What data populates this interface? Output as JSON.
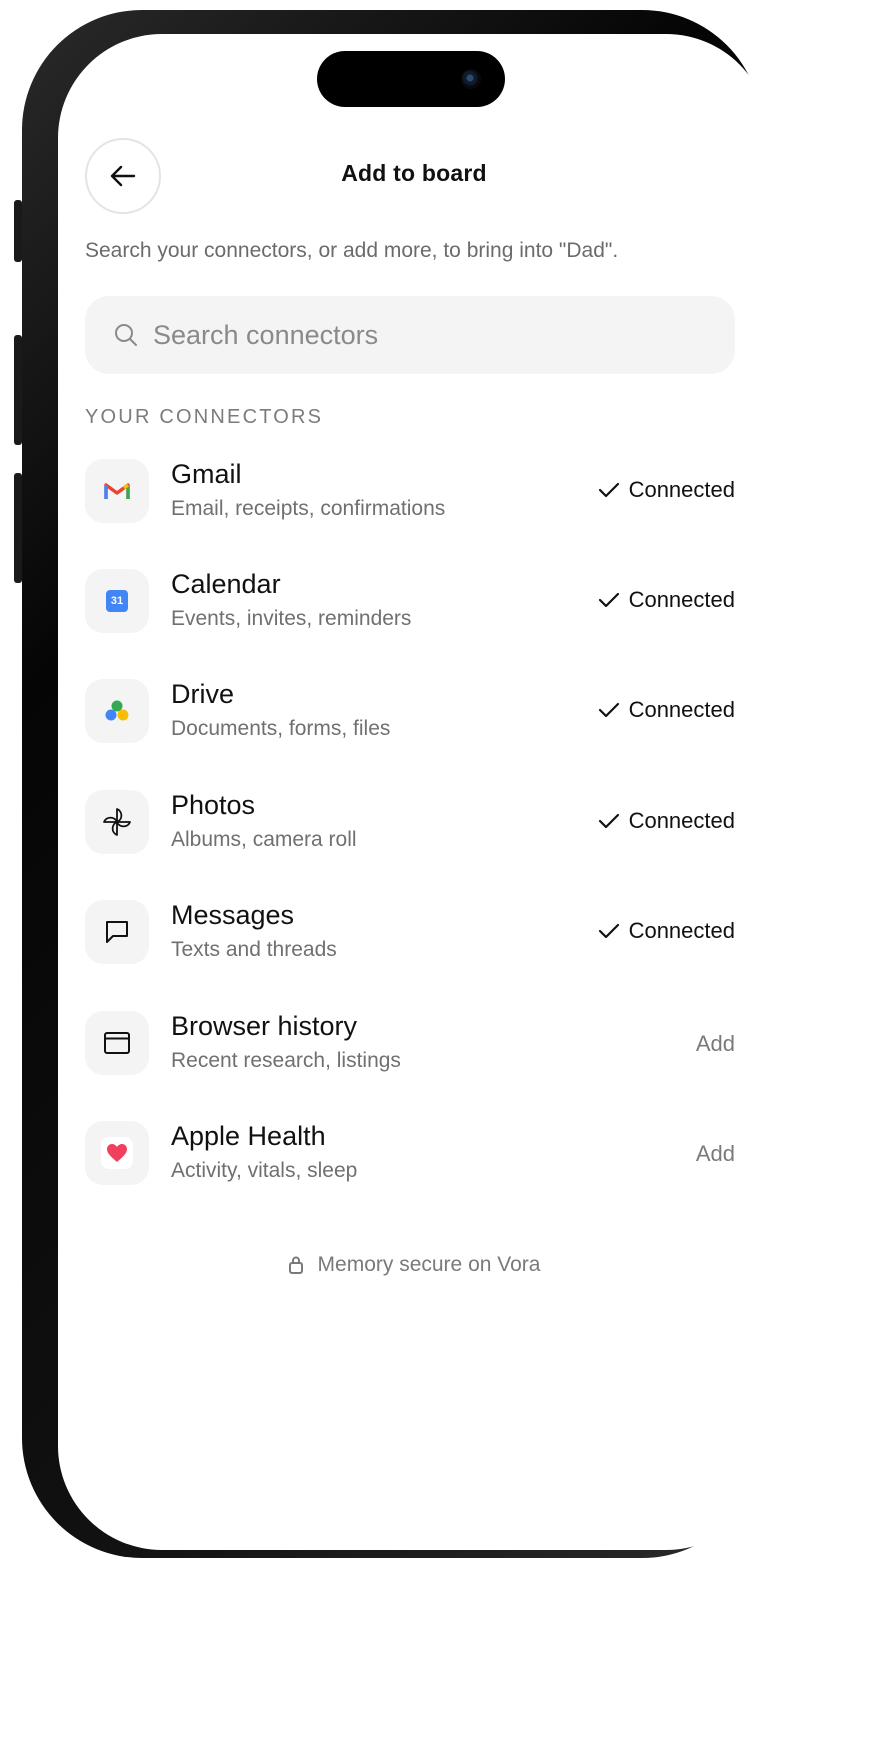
{
  "header": {
    "title": "Add to board",
    "subtitle": "Search your connectors, or add more, to bring into \"Dad\"."
  },
  "search": {
    "placeholder": "Search connectors"
  },
  "section_label": "YOUR CONNECTORS",
  "connectors": [
    {
      "name": "Gmail",
      "desc": "Email, receipts, confirmations",
      "status": "Connected",
      "icon": "gmail-icon"
    },
    {
      "name": "Calendar",
      "desc": "Events, invites, reminders",
      "status": "Connected",
      "icon": "calendar-icon",
      "icon_text": "31"
    },
    {
      "name": "Drive",
      "desc": "Documents, forms, files",
      "status": "Connected",
      "icon": "drive-icon"
    },
    {
      "name": "Photos",
      "desc": "Albums, camera roll",
      "status": "Connected",
      "icon": "photos-pinwheel-icon"
    },
    {
      "name": "Messages",
      "desc": "Texts and threads",
      "status": "Connected",
      "icon": "message-bubble-icon"
    },
    {
      "name": "Browser history",
      "desc": "Recent research, listings",
      "action": "Add",
      "icon": "browser-window-icon"
    },
    {
      "name": "Apple Health",
      "desc": "Activity, vitals, sleep",
      "action": "Add",
      "icon": "heart-icon"
    }
  ],
  "footer": {
    "text": "Memory secure on Vora"
  },
  "colors": {
    "accent_heart": "#f0405e",
    "tile_bg": "#f4f4f4",
    "muted_text": "#707070"
  }
}
